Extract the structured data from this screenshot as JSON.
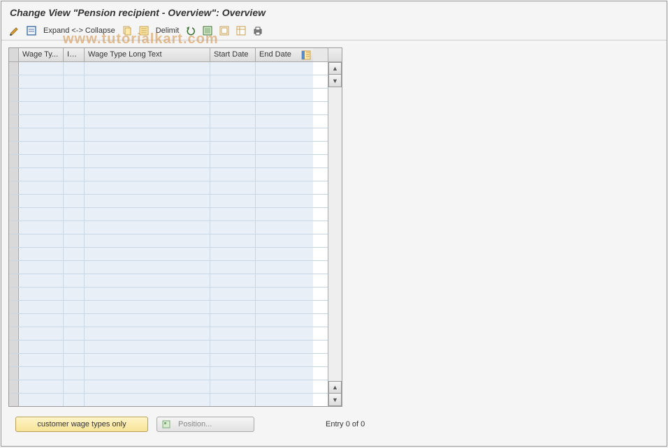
{
  "title": "Change View \"Pension recipient - Overview\": Overview",
  "toolbar": {
    "expand_collapse": "Expand <-> Collapse",
    "delimit": "Delimit"
  },
  "table": {
    "columns": {
      "wage_type": "Wage Ty...",
      "infotype": "Inf...",
      "wage_type_long": "Wage Type Long Text",
      "start_date": "Start Date",
      "end_date": "End Date"
    },
    "rows": []
  },
  "footer": {
    "customer_btn": "customer wage types only",
    "position_btn": "Position...",
    "entry_text": "Entry 0 of 0"
  },
  "watermark": "www.tutorialkart.com"
}
